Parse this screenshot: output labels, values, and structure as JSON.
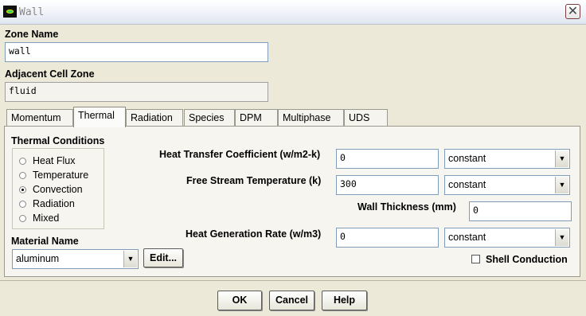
{
  "window": {
    "title": "Wall",
    "close_label": "✕"
  },
  "zone_name": {
    "label": "Zone Name",
    "value": "wall"
  },
  "adjacent_cell_zone": {
    "label": "Adjacent Cell Zone",
    "value": "fluid"
  },
  "tabs": [
    {
      "label": "Momentum",
      "active": false
    },
    {
      "label": "Thermal",
      "active": true
    },
    {
      "label": "Radiation",
      "active": false
    },
    {
      "label": "Species",
      "active": false
    },
    {
      "label": "DPM",
      "active": false
    },
    {
      "label": "Multiphase",
      "active": false
    },
    {
      "label": "UDS",
      "active": false
    }
  ],
  "thermal": {
    "conditions_label": "Thermal Conditions",
    "options": [
      {
        "label": "Heat Flux",
        "selected": false
      },
      {
        "label": "Temperature",
        "selected": false
      },
      {
        "label": "Convection",
        "selected": true
      },
      {
        "label": "Radiation",
        "selected": false
      },
      {
        "label": "Mixed",
        "selected": false
      }
    ],
    "material_label": "Material Name",
    "material_value": "aluminum",
    "edit_label": "Edit...",
    "htc": {
      "label": "Heat Transfer Coefficient (w/m2-k)",
      "value": "0",
      "method": "constant"
    },
    "free_stream": {
      "label": "Free Stream Temperature (k)",
      "value": "300",
      "method": "constant"
    },
    "wall_thickness": {
      "label": "Wall Thickness (mm)",
      "value": "0"
    },
    "heat_gen": {
      "label": "Heat Generation Rate (w/m3)",
      "value": "0",
      "method": "constant"
    },
    "shell_conduction": {
      "label": "Shell Conduction",
      "checked": false
    }
  },
  "buttons": {
    "ok": "OK",
    "cancel": "Cancel",
    "help": "Help"
  }
}
